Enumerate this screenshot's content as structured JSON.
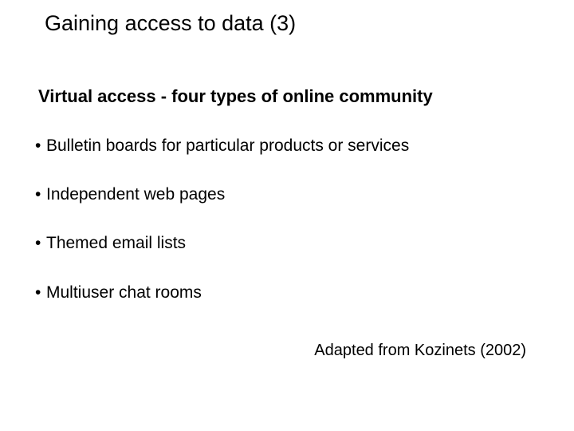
{
  "slide": {
    "title": "Gaining access to data (3)",
    "subheading": "Virtual access - four types of online community",
    "bullets": [
      "Bulletin boards for particular products or services",
      "Independent web pages",
      "Themed email lists",
      "Multiuser chat rooms"
    ],
    "attribution": "Adapted from Kozinets (2002)"
  }
}
